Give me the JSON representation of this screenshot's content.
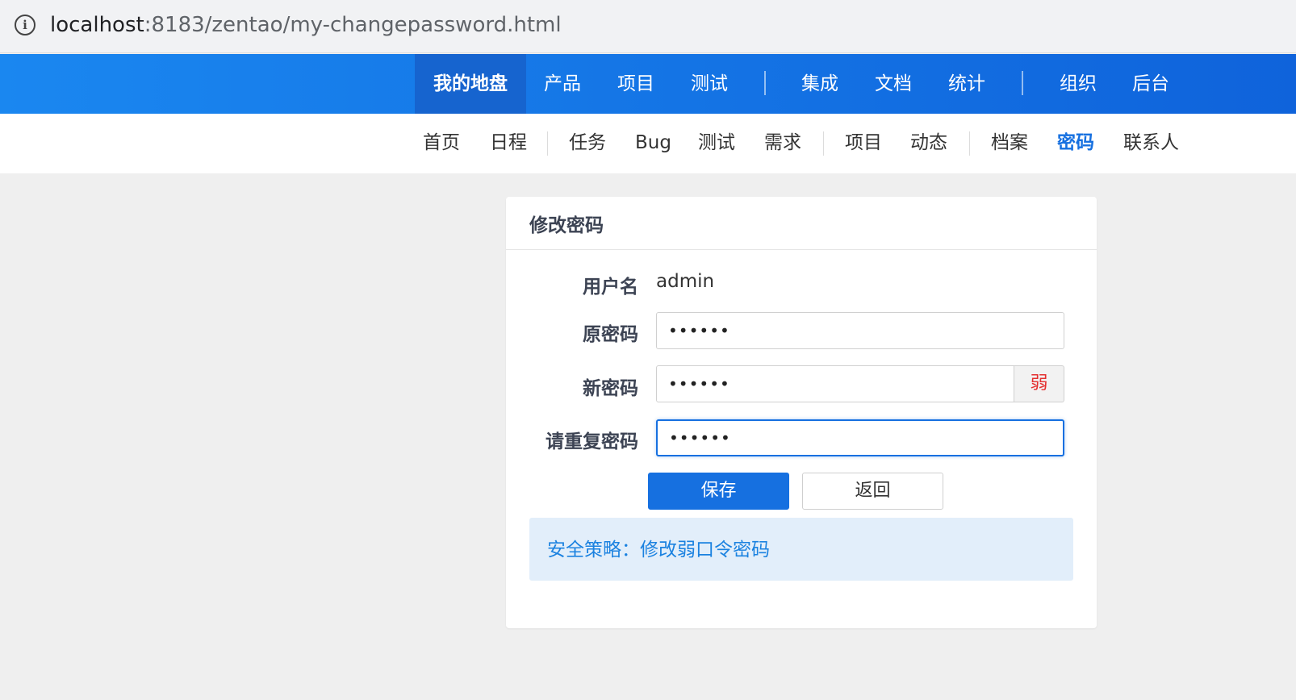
{
  "browser": {
    "url_host": "localhost",
    "url_rest": ":8183/zentao/my-changepassword.html"
  },
  "main_nav": {
    "items": [
      "我的地盘",
      "产品",
      "项目",
      "测试",
      "集成",
      "文档",
      "统计",
      "组织",
      "后台"
    ],
    "active": "我的地盘"
  },
  "sub_nav": {
    "items": [
      "首页",
      "日程",
      "任务",
      "Bug",
      "测试",
      "需求",
      "项目",
      "动态",
      "档案",
      "密码",
      "联系人"
    ],
    "active": "密码"
  },
  "form": {
    "title": "修改密码",
    "username_label": "用户名",
    "username_value": "admin",
    "old_password_label": "原密码",
    "old_password_value": "••••••",
    "new_password_label": "新密码",
    "new_password_value": "••••••",
    "strength_label": "弱",
    "repeat_password_label": "请重复密码",
    "repeat_password_value": "••••••",
    "save_label": "保存",
    "back_label": "返回",
    "notice": "安全策略：修改弱口令密码"
  },
  "colors": {
    "primary": "#1670e0",
    "nav_gradient_start": "#1a87f0",
    "nav_gradient_end": "#0f63db",
    "strength_weak": "#e43030",
    "notice_bg": "#e2eefa",
    "notice_text": "#1b82e0"
  }
}
